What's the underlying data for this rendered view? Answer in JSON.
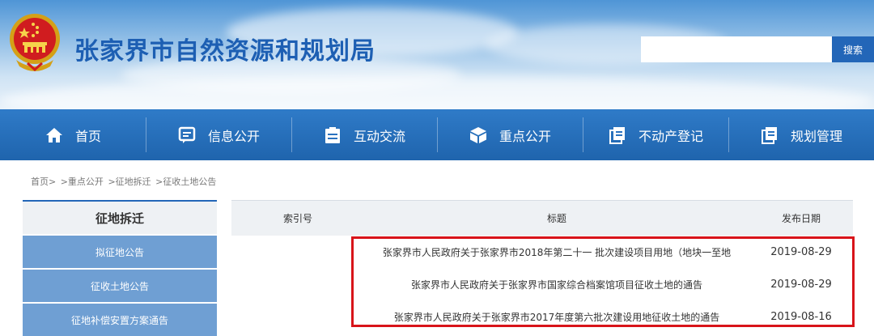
{
  "header": {
    "site_title": "张家界市自然资源和规划局",
    "emblem_icon": "national-emblem-icon"
  },
  "search": {
    "value": "",
    "placeholder": "",
    "button_label": "搜索"
  },
  "nav": {
    "items": [
      {
        "label": "首页",
        "icon": "home-icon"
      },
      {
        "label": "信息公开",
        "icon": "message-icon"
      },
      {
        "label": "互动交流",
        "icon": "clipboard-icon"
      },
      {
        "label": "重点公开",
        "icon": "cube-icon"
      },
      {
        "label": "不动产登记",
        "icon": "document-icon"
      },
      {
        "label": "规划管理",
        "icon": "document-icon"
      }
    ]
  },
  "breadcrumb": [
    "首页>",
    ">重点公开",
    ">征地拆迁",
    ">征收土地公告"
  ],
  "sidebar": {
    "title": "征地拆迁",
    "items": [
      {
        "label": "拟征地公告"
      },
      {
        "label": "征收土地公告"
      },
      {
        "label": "征地补偿安置方案通告"
      }
    ]
  },
  "table": {
    "headers": {
      "index": "索引号",
      "title": "标题",
      "date": "发布日期"
    },
    "rows": [
      {
        "index": "",
        "title": "张家界市人民政府关于张家界市2018年第二十一 批次建设项目用地（地块一至地",
        "date": "2019-08-29"
      },
      {
        "index": "",
        "title": "张家界市人民政府关于张家界市国家综合档案馆项目征收土地的通告",
        "date": "2019-08-29"
      },
      {
        "index": "",
        "title": "张家界市人民政府关于张家界市2017年度第六批次建设用地征收土地的通告",
        "date": "2019-08-16"
      }
    ]
  },
  "colors": {
    "nav_bg": "#2366b8",
    "sidebar_item_bg": "#6f9fd3",
    "title_color": "#1d5fb3",
    "highlight_border": "#d8141a"
  }
}
